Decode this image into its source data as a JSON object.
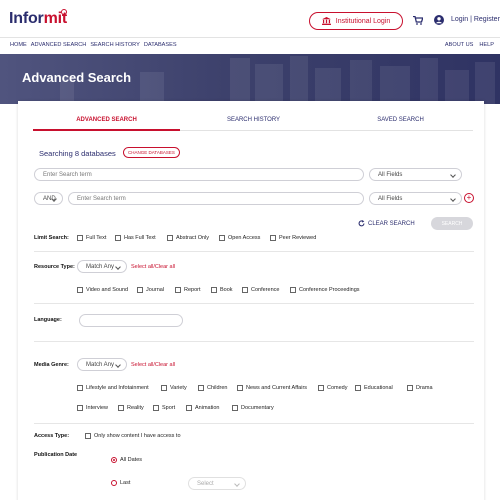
{
  "header": {
    "logo_part1": "Infor",
    "logo_part2": "mit",
    "institutional_login": "Institutional Login",
    "login_register": "Login | Register"
  },
  "nav": {
    "left": [
      "HOME",
      "ADVANCED SEARCH",
      "SEARCH HISTORY",
      "DATABASES"
    ],
    "right": [
      "ABOUT US",
      "HELP"
    ]
  },
  "hero": {
    "title": "Advanced Search"
  },
  "tabs": [
    "ADVANCED SEARCH",
    "SEARCH HISTORY",
    "SAVED SEARCH"
  ],
  "searching": {
    "prefix": "Searching",
    "count": "8 databases",
    "change": "CHANGE DATABASES"
  },
  "search_rows": [
    {
      "placeholder": "Enter Search term",
      "field": "All Fields"
    },
    {
      "operator": "AND",
      "placeholder": "Enter Search term",
      "field": "All Fields"
    }
  ],
  "actions": {
    "clear": "CLEAR SEARCH",
    "search": "SEARCH"
  },
  "limit_search": {
    "label": "Limit Search:",
    "options": [
      "Full Text",
      "Has Full Text",
      "Abstract Only",
      "Open Access",
      "Peer Reviewed"
    ]
  },
  "resource_type": {
    "label": "Resource Type:",
    "match": "Match Any",
    "select_all": "Select all/Clear all",
    "options": [
      "Video and Sound",
      "Journal",
      "Report",
      "Book",
      "Conference",
      "Conference Proceedings"
    ]
  },
  "language": {
    "label": "Language:"
  },
  "media_genre": {
    "label": "Media Genre:",
    "match": "Match Any",
    "select_all": "Select all/Clear all",
    "options_row1": [
      "Lifestyle and Infotainment",
      "Variety",
      "Children",
      "News and Current Affairs",
      "Comedy",
      "Educational",
      "Drama"
    ],
    "options_row2": [
      "Interview",
      "Reality",
      "Sport",
      "Animation",
      "Documentary"
    ]
  },
  "access_type": {
    "label": "Access Type:",
    "option": "Only show content I have access to"
  },
  "publication_date": {
    "label": "Publication Date",
    "all_dates": "All Dates",
    "last": "Last",
    "select": "Select"
  },
  "colors": {
    "brand_red": "#c8102e",
    "brand_navy": "#2b2d6e"
  }
}
